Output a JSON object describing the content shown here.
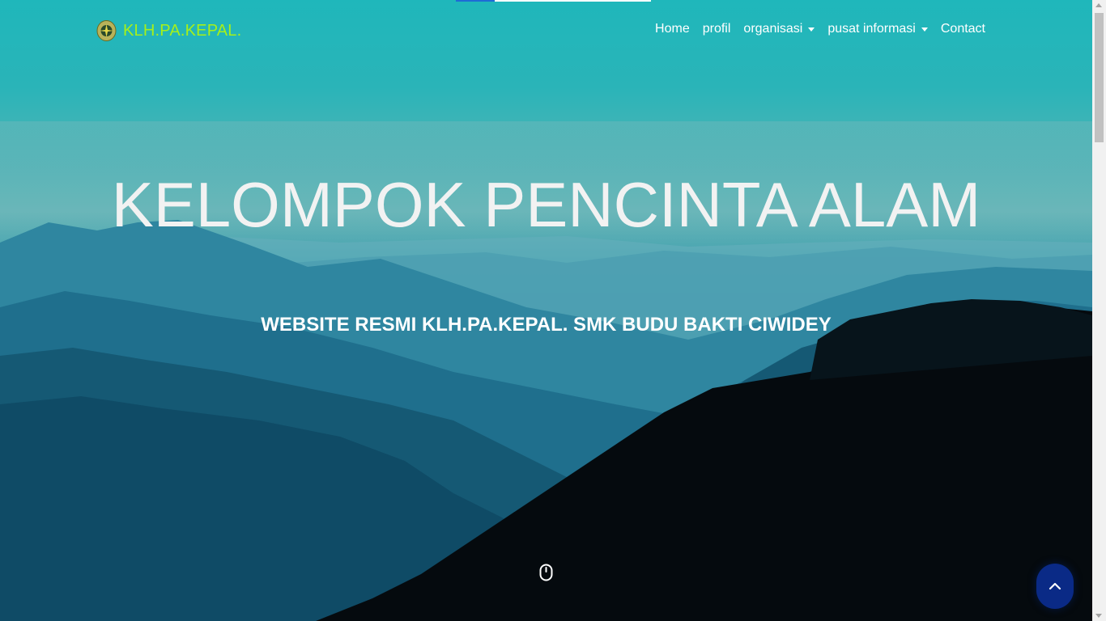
{
  "brand": {
    "name": "KLH.PA.KEPAL.",
    "logo_icon": "compass-emblem-icon",
    "color": "#a6f01a"
  },
  "nav": {
    "items": [
      {
        "label": "Home",
        "has_dropdown": false
      },
      {
        "label": "profil",
        "has_dropdown": false
      },
      {
        "label": "organisasi",
        "has_dropdown": true
      },
      {
        "label": "pusat informasi",
        "has_dropdown": true
      },
      {
        "label": "Contact",
        "has_dropdown": false
      }
    ]
  },
  "hero": {
    "title": "KELOMPOK PENCINTA ALAM",
    "subtitle": "WEBSITE RESMI KLH.PA.KEPAL. SMK BUDU BAKTI CIWIDEY",
    "scroll_icon": "mouse-scroll-icon"
  },
  "back_to_top": {
    "icon": "chevron-up-icon",
    "color": "#0a2a86"
  },
  "colors": {
    "sky_top": "#1fb7bb",
    "load_bar": "#1e6bd6"
  }
}
